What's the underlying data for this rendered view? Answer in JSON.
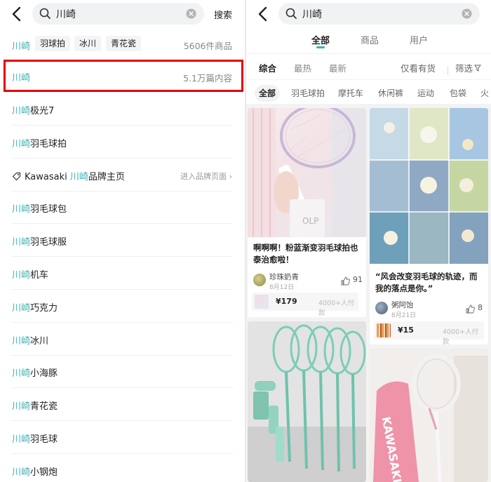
{
  "left": {
    "search_query": "川崎",
    "search_button": "搜索",
    "chips": {
      "first": "川崎",
      "items": [
        "羽球拍",
        "冰川",
        "青花瓷"
      ],
      "count": "5606件商品"
    },
    "highlighted": {
      "text": "川崎",
      "count": "5.1万篇内容"
    },
    "suggestions": [
      {
        "hl": "川崎",
        "rest": "极光7"
      },
      {
        "hl": "川崎",
        "rest": "羽毛球拍"
      },
      {
        "pre": "Kawasaki ",
        "hl": "川崎",
        "rest": "品牌主页",
        "action": "进入品牌页面 ›"
      },
      {
        "hl": "川崎",
        "rest": "羽毛球包"
      },
      {
        "hl": "川崎",
        "rest": "羽毛球服"
      },
      {
        "hl": "川崎",
        "rest": "机车"
      },
      {
        "hl": "川崎",
        "rest": "巧克力"
      },
      {
        "hl": "川崎",
        "rest": "冰川"
      },
      {
        "hl": "川崎",
        "rest": "小海豚"
      },
      {
        "hl": "川崎",
        "rest": "青花瓷"
      },
      {
        "hl": "川崎",
        "rest": "羽毛球"
      },
      {
        "hl": "川崎",
        "rest": "小钢炮"
      }
    ]
  },
  "right": {
    "search_query": "川崎",
    "tabs": [
      "全部",
      "商品",
      "用户"
    ],
    "sort": [
      "综合",
      "最热",
      "最新"
    ],
    "in_stock": "仅看有货",
    "filter": "筛选",
    "categories": [
      "全部",
      "羽毛球拍",
      "摩托车",
      "休闲裤",
      "运动",
      "包袋",
      "火"
    ],
    "cards": [
      {
        "title": "啊啊啊！粉蓝渐变羽毛球拍也泰治愈啦！",
        "author": "珍珠奶青",
        "date": "8月12日",
        "likes": "91",
        "price": "¥179",
        "buyers": "4000+人付款"
      },
      {
        "title": "“风会改变羽毛球的轨迹，而我的落点是你。”",
        "author": "粥阿饴",
        "date": "8月21日",
        "likes": "8",
        "price": "¥15",
        "buyers": "4000+人付款"
      }
    ],
    "brand_text": "KAWASAKI"
  },
  "colors": {
    "accent": "#3bb2b4",
    "highlight_box": "#e30000",
    "panel_bg": "#f3f3f3"
  }
}
